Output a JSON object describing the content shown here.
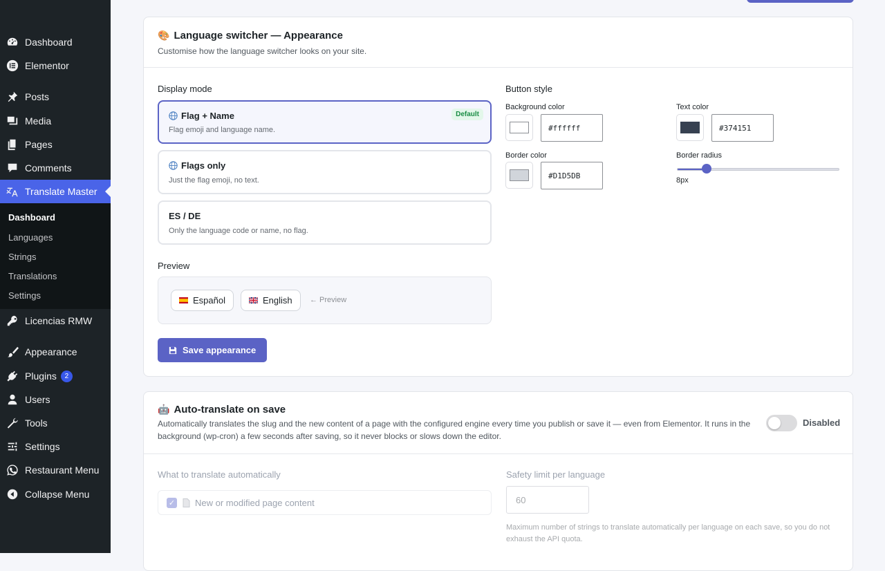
{
  "sidebar": {
    "items": [
      {
        "label": "Dashboard",
        "icon": "dashboard-icon"
      },
      {
        "label": "Elementor",
        "icon": "elementor-icon"
      },
      {
        "label": "Posts",
        "icon": "pin-icon"
      },
      {
        "label": "Media",
        "icon": "media-icon"
      },
      {
        "label": "Pages",
        "icon": "pages-icon"
      },
      {
        "label": "Comments",
        "icon": "comment-icon"
      },
      {
        "label": "Translate Master",
        "icon": "translate-icon"
      },
      {
        "label": "Licencias RMW",
        "icon": "key-icon"
      },
      {
        "label": "Appearance",
        "icon": "brush-icon"
      },
      {
        "label": "Plugins",
        "icon": "plugin-icon",
        "badge": "2"
      },
      {
        "label": "Users",
        "icon": "user-icon"
      },
      {
        "label": "Tools",
        "icon": "wrench-icon"
      },
      {
        "label": "Settings",
        "icon": "settings-icon"
      },
      {
        "label": "Restaurant Menu",
        "icon": "whatsapp-icon"
      },
      {
        "label": "Collapse Menu",
        "icon": "collapse-icon"
      }
    ],
    "submenu": [
      "Dashboard",
      "Languages",
      "Strings",
      "Translations",
      "Settings"
    ],
    "active_item": "Translate Master",
    "current_submenu": "Dashboard"
  },
  "appearance": {
    "title": "Language switcher — Appearance",
    "title_icon": "palette-icon",
    "subtitle": "Customise how the language switcher looks on your site.",
    "display_mode_label": "Display mode",
    "options": [
      {
        "title": "Flag + Name",
        "desc": "Flag emoji and language name.",
        "badge": "Default",
        "icon": "globe-icon",
        "selected": true
      },
      {
        "title": "Flags only",
        "desc": "Just the flag emoji, no text.",
        "icon": "globe-icon",
        "selected": false
      },
      {
        "title": "ES / DE",
        "desc": "Only the language code or name, no flag.",
        "selected": false
      }
    ],
    "preview_label": "Preview",
    "preview": {
      "buttons": [
        {
          "label": "Español",
          "flag": "spain-flag-icon"
        },
        {
          "label": "English",
          "flag": "uk-flag-icon"
        }
      ],
      "note": "← Preview"
    },
    "save_label": "Save appearance",
    "save_icon": "floppy-icon",
    "button_style": {
      "label": "Button style",
      "background_color_label": "Background color",
      "background_color": "#ffffff",
      "text_color_label": "Text color",
      "text_color": "#374151",
      "border_color_label": "Border color",
      "border_color": "#D1D5DB",
      "border_radius_label": "Border radius",
      "border_radius_value": "8px",
      "border_radius_fraction": 0.18
    }
  },
  "autotranslate": {
    "title": "Auto-translate on save",
    "title_icon": "robot-icon",
    "description": "Automatically translates the slug and the new content of a page with the configured engine every time you publish or save it — even from Elementor. It runs in the background (wp-cron) a few seconds after saving, so it never blocks or slows down the editor.",
    "toggle_label": "Disabled",
    "toggle_on": false,
    "what_label": "What to translate automatically",
    "checkbox_label": "New or modified page content",
    "checkbox_checked": true,
    "limit_label": "Safety limit per language",
    "limit_value": "60",
    "limit_help": "Maximum number of strings to translate automatically per language on each save, so you do not exhaust the API quota."
  },
  "colors": {
    "accent": "#5b63c5",
    "sidebar_bg": "#1d2327",
    "sidebar_active": "#4a64e8",
    "default_badge_bg": "#e3f7ea",
    "default_badge_text": "#1a8d45"
  }
}
